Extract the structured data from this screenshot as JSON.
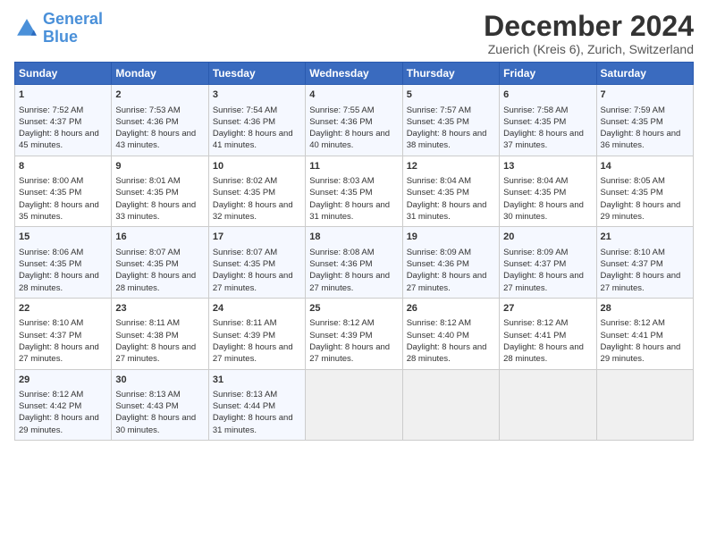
{
  "logo": {
    "line1": "General",
    "line2": "Blue"
  },
  "title": "December 2024",
  "subtitle": "Zuerich (Kreis 6), Zurich, Switzerland",
  "days_of_week": [
    "Sunday",
    "Monday",
    "Tuesday",
    "Wednesday",
    "Thursday",
    "Friday",
    "Saturday"
  ],
  "weeks": [
    [
      {
        "day": "1",
        "sunrise": "Sunrise: 7:52 AM",
        "sunset": "Sunset: 4:37 PM",
        "daylight": "Daylight: 8 hours and 45 minutes."
      },
      {
        "day": "2",
        "sunrise": "Sunrise: 7:53 AM",
        "sunset": "Sunset: 4:36 PM",
        "daylight": "Daylight: 8 hours and 43 minutes."
      },
      {
        "day": "3",
        "sunrise": "Sunrise: 7:54 AM",
        "sunset": "Sunset: 4:36 PM",
        "daylight": "Daylight: 8 hours and 41 minutes."
      },
      {
        "day": "4",
        "sunrise": "Sunrise: 7:55 AM",
        "sunset": "Sunset: 4:36 PM",
        "daylight": "Daylight: 8 hours and 40 minutes."
      },
      {
        "day": "5",
        "sunrise": "Sunrise: 7:57 AM",
        "sunset": "Sunset: 4:35 PM",
        "daylight": "Daylight: 8 hours and 38 minutes."
      },
      {
        "day": "6",
        "sunrise": "Sunrise: 7:58 AM",
        "sunset": "Sunset: 4:35 PM",
        "daylight": "Daylight: 8 hours and 37 minutes."
      },
      {
        "day": "7",
        "sunrise": "Sunrise: 7:59 AM",
        "sunset": "Sunset: 4:35 PM",
        "daylight": "Daylight: 8 hours and 36 minutes."
      }
    ],
    [
      {
        "day": "8",
        "sunrise": "Sunrise: 8:00 AM",
        "sunset": "Sunset: 4:35 PM",
        "daylight": "Daylight: 8 hours and 35 minutes."
      },
      {
        "day": "9",
        "sunrise": "Sunrise: 8:01 AM",
        "sunset": "Sunset: 4:35 PM",
        "daylight": "Daylight: 8 hours and 33 minutes."
      },
      {
        "day": "10",
        "sunrise": "Sunrise: 8:02 AM",
        "sunset": "Sunset: 4:35 PM",
        "daylight": "Daylight: 8 hours and 32 minutes."
      },
      {
        "day": "11",
        "sunrise": "Sunrise: 8:03 AM",
        "sunset": "Sunset: 4:35 PM",
        "daylight": "Daylight: 8 hours and 31 minutes."
      },
      {
        "day": "12",
        "sunrise": "Sunrise: 8:04 AM",
        "sunset": "Sunset: 4:35 PM",
        "daylight": "Daylight: 8 hours and 31 minutes."
      },
      {
        "day": "13",
        "sunrise": "Sunrise: 8:04 AM",
        "sunset": "Sunset: 4:35 PM",
        "daylight": "Daylight: 8 hours and 30 minutes."
      },
      {
        "day": "14",
        "sunrise": "Sunrise: 8:05 AM",
        "sunset": "Sunset: 4:35 PM",
        "daylight": "Daylight: 8 hours and 29 minutes."
      }
    ],
    [
      {
        "day": "15",
        "sunrise": "Sunrise: 8:06 AM",
        "sunset": "Sunset: 4:35 PM",
        "daylight": "Daylight: 8 hours and 28 minutes."
      },
      {
        "day": "16",
        "sunrise": "Sunrise: 8:07 AM",
        "sunset": "Sunset: 4:35 PM",
        "daylight": "Daylight: 8 hours and 28 minutes."
      },
      {
        "day": "17",
        "sunrise": "Sunrise: 8:07 AM",
        "sunset": "Sunset: 4:35 PM",
        "daylight": "Daylight: 8 hours and 27 minutes."
      },
      {
        "day": "18",
        "sunrise": "Sunrise: 8:08 AM",
        "sunset": "Sunset: 4:36 PM",
        "daylight": "Daylight: 8 hours and 27 minutes."
      },
      {
        "day": "19",
        "sunrise": "Sunrise: 8:09 AM",
        "sunset": "Sunset: 4:36 PM",
        "daylight": "Daylight: 8 hours and 27 minutes."
      },
      {
        "day": "20",
        "sunrise": "Sunrise: 8:09 AM",
        "sunset": "Sunset: 4:37 PM",
        "daylight": "Daylight: 8 hours and 27 minutes."
      },
      {
        "day": "21",
        "sunrise": "Sunrise: 8:10 AM",
        "sunset": "Sunset: 4:37 PM",
        "daylight": "Daylight: 8 hours and 27 minutes."
      }
    ],
    [
      {
        "day": "22",
        "sunrise": "Sunrise: 8:10 AM",
        "sunset": "Sunset: 4:37 PM",
        "daylight": "Daylight: 8 hours and 27 minutes."
      },
      {
        "day": "23",
        "sunrise": "Sunrise: 8:11 AM",
        "sunset": "Sunset: 4:38 PM",
        "daylight": "Daylight: 8 hours and 27 minutes."
      },
      {
        "day": "24",
        "sunrise": "Sunrise: 8:11 AM",
        "sunset": "Sunset: 4:39 PM",
        "daylight": "Daylight: 8 hours and 27 minutes."
      },
      {
        "day": "25",
        "sunrise": "Sunrise: 8:12 AM",
        "sunset": "Sunset: 4:39 PM",
        "daylight": "Daylight: 8 hours and 27 minutes."
      },
      {
        "day": "26",
        "sunrise": "Sunrise: 8:12 AM",
        "sunset": "Sunset: 4:40 PM",
        "daylight": "Daylight: 8 hours and 28 minutes."
      },
      {
        "day": "27",
        "sunrise": "Sunrise: 8:12 AM",
        "sunset": "Sunset: 4:41 PM",
        "daylight": "Daylight: 8 hours and 28 minutes."
      },
      {
        "day": "28",
        "sunrise": "Sunrise: 8:12 AM",
        "sunset": "Sunset: 4:41 PM",
        "daylight": "Daylight: 8 hours and 29 minutes."
      }
    ],
    [
      {
        "day": "29",
        "sunrise": "Sunrise: 8:12 AM",
        "sunset": "Sunset: 4:42 PM",
        "daylight": "Daylight: 8 hours and 29 minutes."
      },
      {
        "day": "30",
        "sunrise": "Sunrise: 8:13 AM",
        "sunset": "Sunset: 4:43 PM",
        "daylight": "Daylight: 8 hours and 30 minutes."
      },
      {
        "day": "31",
        "sunrise": "Sunrise: 8:13 AM",
        "sunset": "Sunset: 4:44 PM",
        "daylight": "Daylight: 8 hours and 31 minutes."
      },
      null,
      null,
      null,
      null
    ]
  ]
}
